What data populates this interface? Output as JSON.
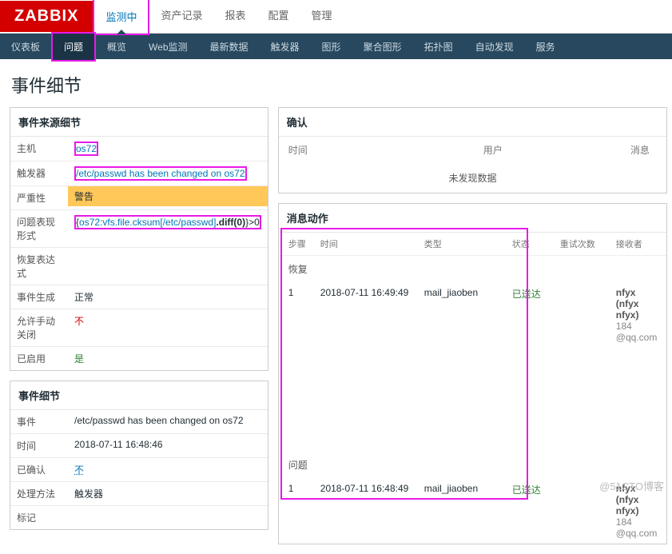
{
  "logo": "ZABBIX",
  "topnav": [
    "监测中",
    "资产记录",
    "报表",
    "配置",
    "管理"
  ],
  "topnav_active": 0,
  "subnav": [
    "仪表板",
    "问题",
    "概览",
    "Web监测",
    "最新数据",
    "触发器",
    "图形",
    "聚合图形",
    "拓扑图",
    "自动发现",
    "服务"
  ],
  "subnav_active": 1,
  "page_title": "事件细节",
  "source": {
    "title": "事件来源细节",
    "host_label": "主机",
    "host_value": "os72",
    "trigger_label": "触发器",
    "trigger_value": "/etc/passwd has been changed on os72",
    "severity_label": "严重性",
    "severity_value": "警告",
    "expr_label": "问题表现形式",
    "expr_host": "os72:vfs.file.cksum[/etc/passwd]",
    "expr_diff": ".diff(0)",
    "expr_tail": "}>0",
    "recovery_label": "恢复表达式",
    "gen_label": "事件生成",
    "gen_value": "正常",
    "manual_label": "允许手动关闭",
    "manual_value": "不",
    "enabled_label": "已启用",
    "enabled_value": "是"
  },
  "detail": {
    "title": "事件细节",
    "event_label": "事件",
    "event_value": "/etc/passwd has been changed on os72",
    "time_label": "时间",
    "time_value": "2018-07-11 16:48:46",
    "ack_label": "已确认",
    "ack_value": "不",
    "process_label": "处理方法",
    "process_value": "触发器",
    "tag_label": "标记"
  },
  "confirm": {
    "title": "确认",
    "col_time": "时间",
    "col_user": "用户",
    "col_msg": "消息",
    "no_data": "未发现数据"
  },
  "actions": {
    "title": "消息动作",
    "head": {
      "step": "步骤",
      "time": "时间",
      "type": "类型",
      "status": "状态",
      "retry": "重试次数",
      "recv": "接收者"
    },
    "recovery_label": "恢复",
    "problem_label": "问题",
    "rows": [
      {
        "step": "1",
        "time": "2018-07-11 16:49:49",
        "type": "mail_jiaoben",
        "status": "已送达",
        "recv_name": "nfyx (nfyx nfyx)",
        "recv_email": "184            @qq.com"
      },
      {
        "step": "1",
        "time": "2018-07-11 16:48:49",
        "type": "mail_jiaoben",
        "status": "已送达",
        "recv_name": "nfyx (nfyx nfyx)",
        "recv_email": "184            @qq.com"
      }
    ]
  },
  "watermark": "@51CTO博客"
}
